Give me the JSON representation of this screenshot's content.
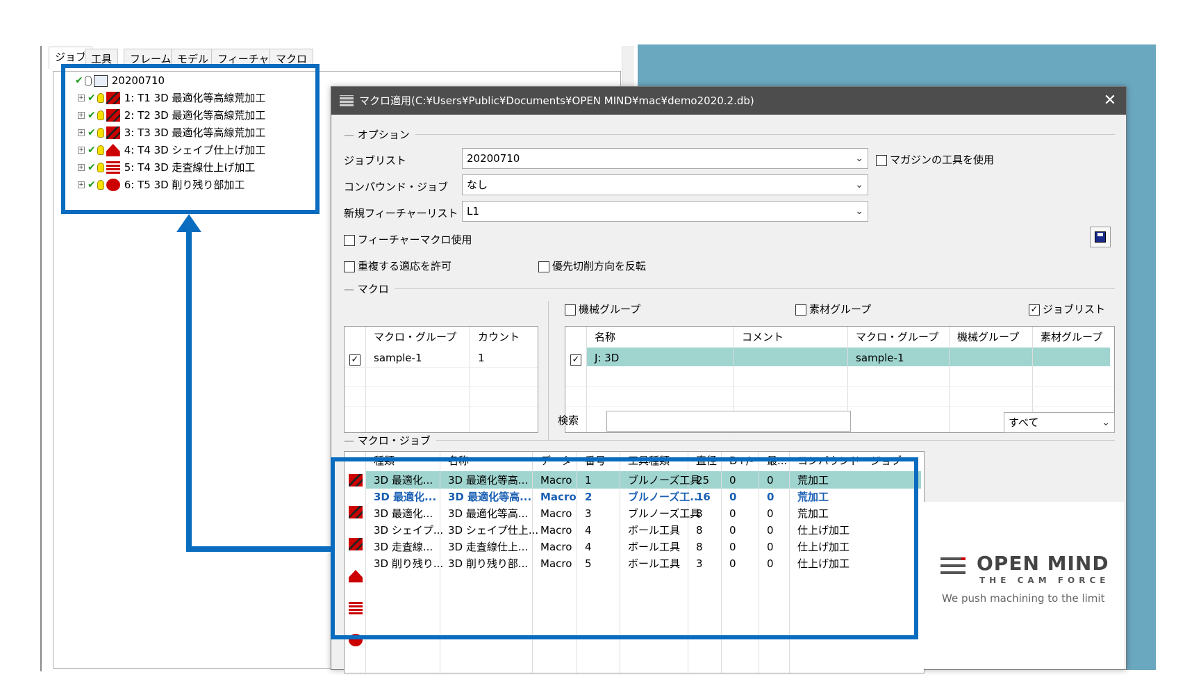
{
  "left_panel": {
    "tabs": [
      "ジョブ",
      "工具",
      "フレーム",
      "モデル",
      "フィーチャー",
      "マクロ"
    ],
    "tree_root": "20200710",
    "tree_items": [
      {
        "label": "1: T1 3D 最適化等高線荒加工",
        "icon": "optimized-roughing-icon"
      },
      {
        "label": "2: T2 3D 最適化等高線荒加工",
        "icon": "optimized-roughing-icon"
      },
      {
        "label": "3: T3 3D 最適化等高線荒加工",
        "icon": "optimized-roughing-icon"
      },
      {
        "label": "4: T4 3D シェイプ仕上げ加工",
        "icon": "shape-finishing-icon"
      },
      {
        "label": "5: T4 3D 走査線仕上げ加工",
        "icon": "scanline-finishing-icon"
      },
      {
        "label": "6: T5 3D 削り残り部加工",
        "icon": "rest-machining-icon"
      }
    ]
  },
  "dialog": {
    "title": "マクロ適用(C:¥Users¥Public¥Documents¥OPEN MIND¥mac¥demo2020.2.db)",
    "close": "✕",
    "options_group": "オプション",
    "joblist_label": "ジョブリスト",
    "joblist_value": "20200710",
    "compound_label": "コンパウンド・ジョブ",
    "compound_value": "なし",
    "feature_list_label": "新規フィーチャーリスト",
    "feature_list_value": "L1",
    "magazine_tool": "マガジンの工具を使用",
    "feature_macro": "フィーチャーマクロ使用",
    "allow_duplicate": "重複する適応を許可",
    "reverse_priority": "優先切削方向を反転",
    "macro_group": "マクロ",
    "machine_group_cb": "機械グループ",
    "material_group_cb": "素材グループ",
    "joblist_cb": "ジョブリスト",
    "macro_group_table": {
      "headers": [
        "マクロ・グループ",
        "カウント"
      ],
      "rows": [
        {
          "name": "sample-1",
          "count": "1"
        }
      ]
    },
    "macro_table": {
      "headers": [
        "名称",
        "コメント",
        "マクロ・グループ",
        "機械グループ",
        "素材グループ"
      ],
      "rows": [
        {
          "name": "J: 3D",
          "comment": "",
          "group": "sample-1",
          "machine": "",
          "material": ""
        }
      ]
    },
    "search_label": "検索",
    "filter_value": "すべて",
    "macro_job_group": "マクロ・ジョブ",
    "job_table": {
      "headers": [
        "種類",
        "名称",
        "データ",
        "番号",
        "工具種類",
        "直径",
        "D+/-",
        "最...",
        "コンパウンド・ジョブ"
      ],
      "rows": [
        {
          "type": "3D 最適化...",
          "name": "3D 最適化等高...",
          "data": "Macro",
          "num": "1",
          "tool": "ブルノーズ工具",
          "dia": "25",
          "d": "0",
          "max": "0",
          "compound": "荒加工",
          "icon": "optimized-roughing-icon"
        },
        {
          "type": "3D 最適化...",
          "name": "3D 最適化等高...",
          "data": "Macro",
          "num": "2",
          "tool": "ブルノーズ工...",
          "dia": "16",
          "d": "0",
          "max": "0",
          "compound": "荒加工",
          "icon": "optimized-roughing-icon"
        },
        {
          "type": "3D 最適化...",
          "name": "3D 最適化等高...",
          "data": "Macro",
          "num": "3",
          "tool": "ブルノーズ工具",
          "dia": "8",
          "d": "0",
          "max": "0",
          "compound": "荒加工",
          "icon": "optimized-roughing-icon"
        },
        {
          "type": "3D シェイプ...",
          "name": "3D シェイプ仕上...",
          "data": "Macro",
          "num": "4",
          "tool": "ボール工具",
          "dia": "8",
          "d": "0",
          "max": "0",
          "compound": "仕上げ加工",
          "icon": "shape-finishing-icon"
        },
        {
          "type": "3D 走査線...",
          "name": "3D 走査線仕上...",
          "data": "Macro",
          "num": "4",
          "tool": "ボール工具",
          "dia": "8",
          "d": "0",
          "max": "0",
          "compound": "仕上げ加工",
          "icon": "scanline-finishing-icon"
        },
        {
          "type": "3D 削り残り...",
          "name": "3D 削り残り部...",
          "data": "Macro",
          "num": "5",
          "tool": "ボール工具",
          "dia": "3",
          "d": "0",
          "max": "0",
          "compound": "仕上げ加工",
          "icon": "rest-machining-icon"
        }
      ]
    },
    "logo": {
      "line1": "OPEN MIND",
      "line2": "THE CAM FORCE",
      "tagline": "We push machining to the limit"
    }
  },
  "colors": {
    "highlight_box": "#0a6cbf",
    "selected_row": "#9fd4cf",
    "link_blue": "#1a5fb4"
  }
}
